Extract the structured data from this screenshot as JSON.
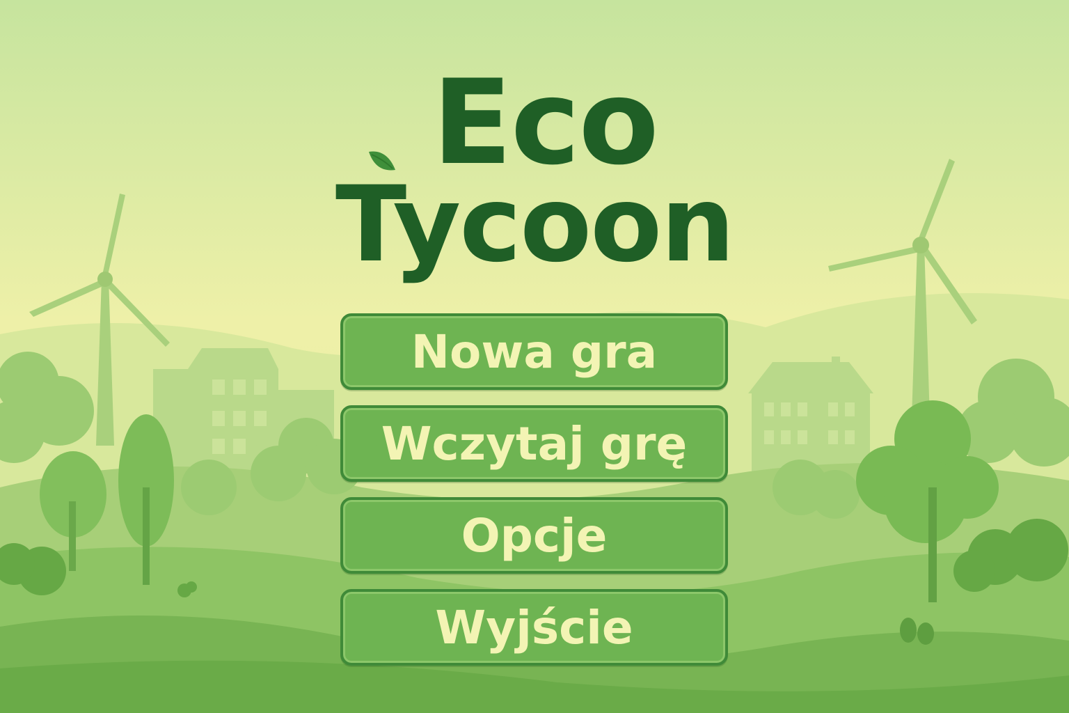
{
  "title": {
    "line1": "Eco",
    "line2": "Tycoon"
  },
  "menu": {
    "new_game": "Nowa gra",
    "load_game": "Wczytaj grę",
    "options": "Opcje",
    "exit": "Wyjście"
  },
  "colors": {
    "title_text": "#1f5f26",
    "button_fill": "#6eb452",
    "button_border": "#3f8a38",
    "button_text": "#f3f4b4",
    "sky_top": "#c8e5a0",
    "sky_bottom": "#eef0a6",
    "leaf": "#3f8f3a"
  },
  "icons": {
    "logo_leaf": "leaf-icon"
  }
}
